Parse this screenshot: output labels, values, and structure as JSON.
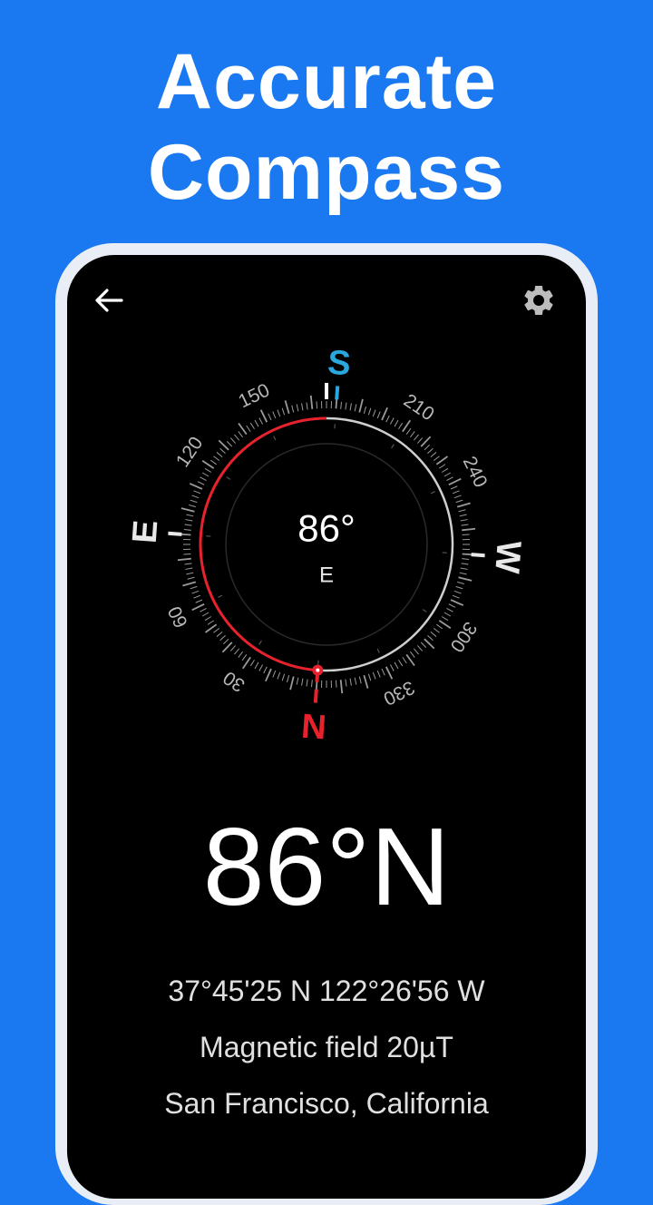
{
  "promo": {
    "line1": "Accurate",
    "line2": "Compass"
  },
  "toolbar": {
    "back_icon": "arrow-left-icon",
    "settings_icon": "gear-icon"
  },
  "compass": {
    "heading_deg": 86,
    "center_reading": "86°",
    "center_direction": "E",
    "cardinals": {
      "north": "N",
      "east": "E",
      "south": "S",
      "west": "W"
    },
    "dial_numbers": [
      "30",
      "60",
      "120",
      "150",
      "210",
      "240",
      "300",
      "330"
    ],
    "colors": {
      "north": "#e8222c",
      "south": "#2aa7df",
      "ring": "#cfcfcf",
      "accent": "#e8222c"
    }
  },
  "readout": {
    "heading": "86°N",
    "coordinates": "37°45'25 N  122°26'56 W",
    "magnetic_field": "Magnetic field 20µT",
    "location": "San Francisco, California"
  }
}
